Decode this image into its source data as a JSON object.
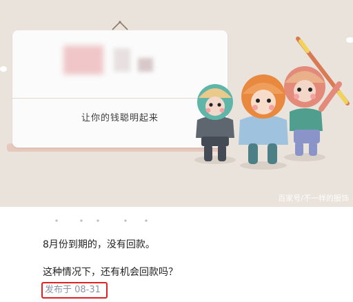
{
  "banner": {
    "board_caption": "让你的钱聪明起来",
    "watermark": "百家号/不一样的服饰"
  },
  "post": {
    "line1": "8月份到期的，没有回款。",
    "line2": "这种情况下，还有机会回款吗？",
    "date": "发布于 08-31"
  },
  "colors": {
    "banner_bg": "#eae3db",
    "highlight_border": "#e02020",
    "date_text": "#8a93a6"
  }
}
